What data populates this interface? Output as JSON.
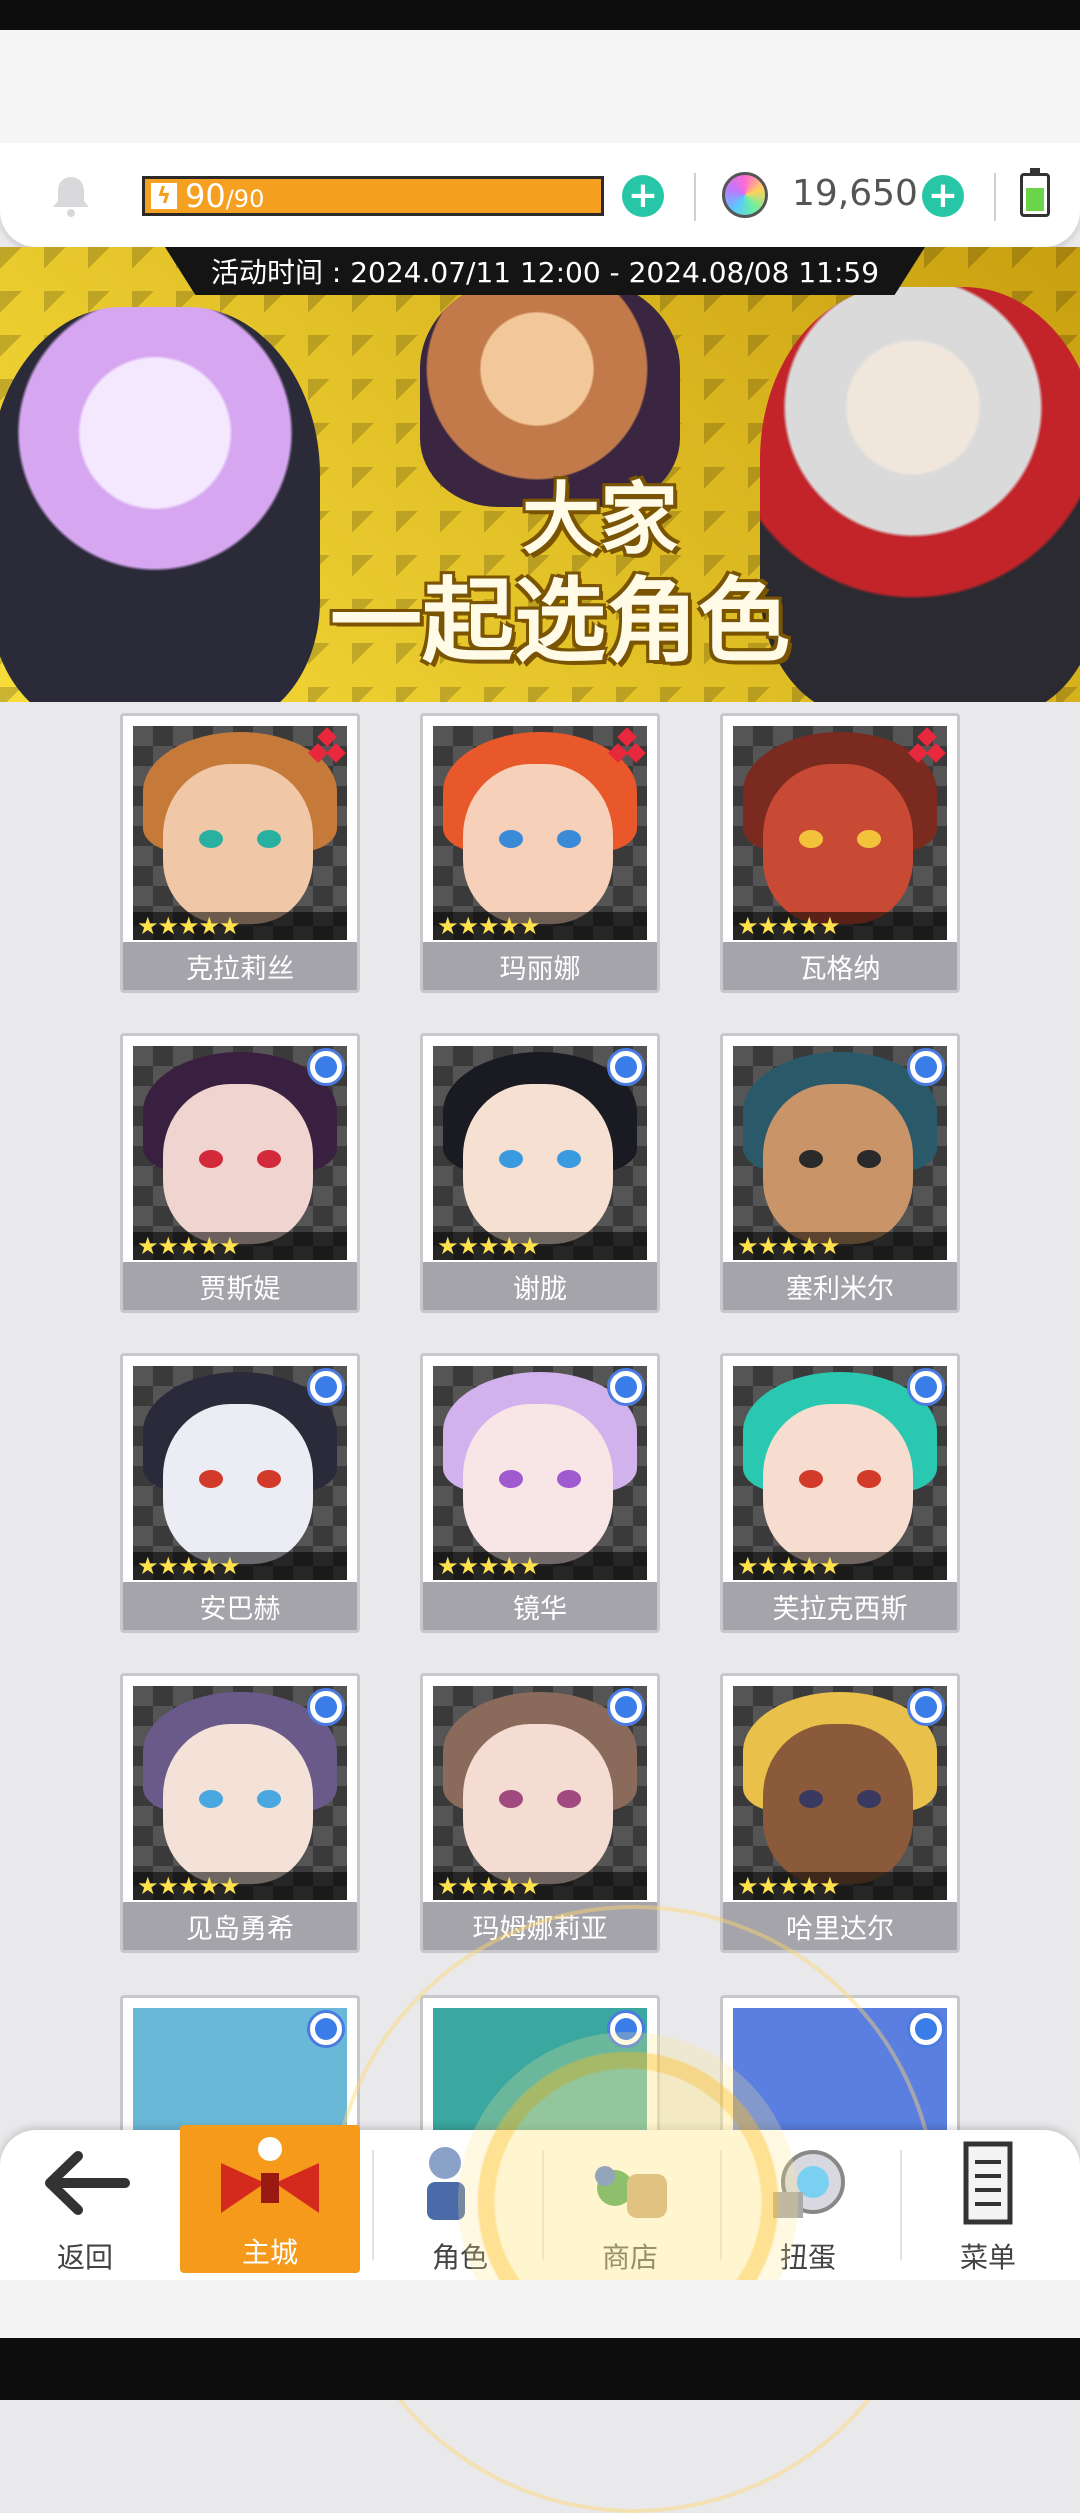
{
  "resources": {
    "stamina_current": "90",
    "stamina_max": "/90",
    "gems": "19,650"
  },
  "banner": {
    "time_text": "活动时间 : 2024.07/11 12:00 - 2024.08/08 11:59",
    "title_line1": "大家",
    "title_line2": "一起选角色"
  },
  "characters": [
    {
      "name": "克拉莉丝",
      "badge": "red",
      "stars": "★★★★★"
    },
    {
      "name": "玛丽娜",
      "badge": "red",
      "stars": "★★★★★"
    },
    {
      "name": "瓦格纳",
      "badge": "red",
      "stars": "★★★★★"
    },
    {
      "name": "贾斯媞",
      "badge": "blue",
      "stars": "★★★★★"
    },
    {
      "name": "谢胧",
      "badge": "blue",
      "stars": "★★★★★"
    },
    {
      "name": "塞利米尔",
      "badge": "blue",
      "stars": "★★★★★"
    },
    {
      "name": "安巴赫",
      "badge": "blue",
      "stars": "★★★★★"
    },
    {
      "name": "镜华",
      "badge": "blue",
      "stars": "★★★★★"
    },
    {
      "name": "芙拉克西斯",
      "badge": "blue",
      "stars": "★★★★★"
    },
    {
      "name": "见岛勇希",
      "badge": "blue",
      "stars": "★★★★★"
    },
    {
      "name": "玛姆娜莉亚",
      "badge": "blue",
      "stars": "★★★★★"
    },
    {
      "name": "哈里达尔",
      "badge": "blue",
      "stars": "★★★★★"
    }
  ],
  "bottom_nav": [
    {
      "label": "返回",
      "icon": "back-arrow-icon"
    },
    {
      "label": "主城",
      "icon": "castle-icon"
    },
    {
      "label": "角色",
      "icon": "character-icon"
    },
    {
      "label": "商店",
      "icon": "shop-bag-icon"
    },
    {
      "label": "扭蛋",
      "icon": "gacha-icon"
    },
    {
      "label": "菜单",
      "icon": "menu-list-icon"
    }
  ],
  "colors": {
    "accent_orange": "#f59a1a",
    "plus_teal": "#26c6a6",
    "badge_red": "#e8283c",
    "badge_blue": "#3a7de8"
  }
}
